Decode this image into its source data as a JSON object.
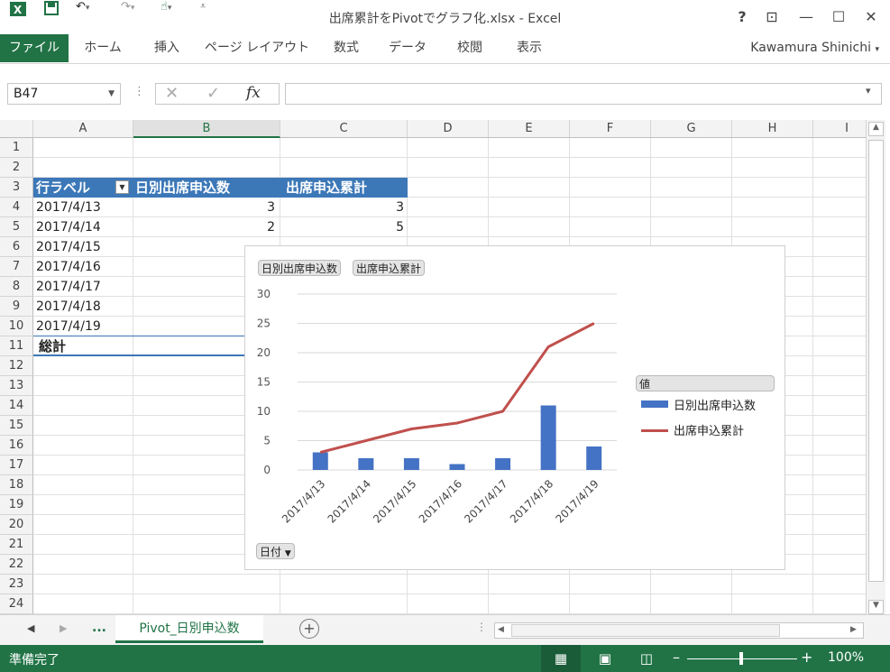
{
  "title": "出席累計をPivotでグラフ化.xlsx - Excel",
  "window_buttons": [
    "?",
    "⊡",
    "—",
    "☐",
    "✕"
  ],
  "ribbon": {
    "tabs": [
      "ファイル",
      "ホーム",
      "挿入",
      "ページ レイアウト",
      "数式",
      "データ",
      "校閲",
      "表示"
    ],
    "user": "Kawamura Shinichi"
  },
  "formula_bar": {
    "name_box": "B47",
    "fx": "fx",
    "formula": ""
  },
  "grid": {
    "columns": [
      "A",
      "B",
      "C",
      "D",
      "E",
      "F",
      "G",
      "H",
      "I"
    ],
    "rows": [
      "1",
      "2",
      "3",
      "4",
      "5",
      "6",
      "7",
      "8",
      "9",
      "10",
      "11",
      "12",
      "13",
      "14",
      "15",
      "16",
      "17",
      "18",
      "19",
      "20",
      "21",
      "22",
      "23",
      "24"
    ],
    "pivot": {
      "headers": [
        "行ラベル",
        "日別出席申込数",
        "出席申込累計"
      ],
      "rows": [
        {
          "label": "2017/4/13",
          "daily": "3",
          "cumulative": "3"
        },
        {
          "label": "2017/4/14",
          "daily": "2",
          "cumulative": "5"
        },
        {
          "label": "2017/4/15",
          "daily": "",
          "cumulative": ""
        },
        {
          "label": "2017/4/16",
          "daily": "",
          "cumulative": ""
        },
        {
          "label": "2017/4/17",
          "daily": "",
          "cumulative": ""
        },
        {
          "label": "2017/4/18",
          "daily": "",
          "cumulative": ""
        },
        {
          "label": "2017/4/19",
          "daily": "",
          "cumulative": ""
        }
      ],
      "total_label": "総計"
    }
  },
  "chart": {
    "field_buttons": [
      "日別出席申込数",
      "出席申込累計"
    ],
    "axis_button": "日付",
    "legend_title": "値"
  },
  "chart_data": {
    "type": "bar",
    "categories": [
      "2017/4/13",
      "2017/4/14",
      "2017/4/15",
      "2017/4/16",
      "2017/4/17",
      "2017/4/18",
      "2017/4/19"
    ],
    "series": [
      {
        "name": "日別出席申込数",
        "type": "bar",
        "color": "#4472c4",
        "values": [
          3,
          2,
          2,
          1,
          2,
          11,
          4
        ]
      },
      {
        "name": "出席申込累計",
        "type": "line",
        "color": "#c0504d",
        "values": [
          3,
          5,
          7,
          8,
          10,
          21,
          25
        ]
      }
    ],
    "ylim": [
      0,
      30
    ],
    "yticks": [
      "0",
      "5",
      "10",
      "15",
      "20",
      "25",
      "30"
    ],
    "grid": true,
    "legend": "right"
  },
  "sheet_tabs": {
    "active": "Pivot_日別申込数",
    "more": "..."
  },
  "status": {
    "text": "準備完了",
    "zoom": "100%"
  }
}
